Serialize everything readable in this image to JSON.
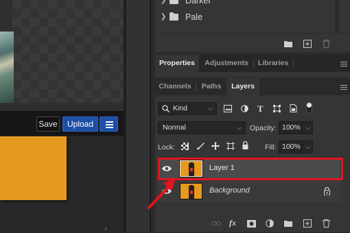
{
  "left_panel": {
    "save_label": "Save",
    "upload_label": "Upload"
  },
  "groups_panel": {
    "items": [
      {
        "label": "Darker"
      },
      {
        "label": "Pale"
      }
    ]
  },
  "tabs_top": [
    {
      "label": "Properties",
      "active": true
    },
    {
      "label": "Adjustments",
      "active": false
    },
    {
      "label": "Libraries",
      "active": false
    }
  ],
  "tabs_bottom": [
    {
      "label": "Channels",
      "active": false
    },
    {
      "label": "Paths",
      "active": false
    },
    {
      "label": "Layers",
      "active": true
    }
  ],
  "layers_panel": {
    "filter_kind": "Kind",
    "blend_mode": "Normal",
    "opacity_label": "Opacity:",
    "opacity_value": "100%",
    "lock_label": "Lock:",
    "fill_label": "Fill:",
    "fill_value": "100%",
    "layers": [
      {
        "name": "Layer 1",
        "visible": true,
        "selected": true,
        "locked": false
      },
      {
        "name": "Background",
        "visible": true,
        "selected": false,
        "locked": true
      }
    ]
  },
  "annotations": {
    "highlight_color": "#e2141e",
    "arrow_color": "#e2141e"
  },
  "colors": {
    "accent_blue": "#1c4fa5",
    "canvas_orange": "#e59a1f"
  }
}
